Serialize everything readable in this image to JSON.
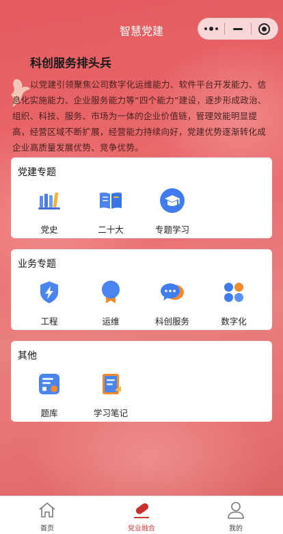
{
  "header": {
    "title": "智慧党建"
  },
  "intro": {
    "title": "科创服务排头兵",
    "text": "以党建引领聚焦公司数字化运维能力、软件平台开发能力、信息化实施能力、企业服务能力等“四个能力”建设，逐步形成政治、组织、科技、服务、市场为一体的企业价值链，管理效能明显提高，经营区域不断扩展，经营能力持续向好，党建优势逐渐转化成企业高质量发展优势、竞争优势。"
  },
  "sections": {
    "party": {
      "title": "党建专题",
      "items": [
        {
          "label": "党史",
          "icon": "books-icon"
        },
        {
          "label": "二十大",
          "icon": "open-book-icon"
        },
        {
          "label": "专题学习",
          "icon": "graduation-cap-icon"
        }
      ]
    },
    "business": {
      "title": "业务专题",
      "items": [
        {
          "label": "工程",
          "icon": "lightning-shield-icon"
        },
        {
          "label": "运维",
          "icon": "badge-icon"
        },
        {
          "label": "科创服务",
          "icon": "chat-bubbles-icon"
        },
        {
          "label": "数字化",
          "icon": "four-petal-icon"
        }
      ]
    },
    "other": {
      "title": "其他",
      "items": [
        {
          "label": "题库",
          "icon": "question-bank-icon"
        },
        {
          "label": "学习笔记",
          "icon": "notebook-icon"
        }
      ]
    }
  },
  "tabbar": {
    "items": [
      {
        "label": "首页",
        "icon": "home-icon"
      },
      {
        "label": "党业融合",
        "icon": "pill-icon",
        "active": true
      },
      {
        "label": "我的",
        "icon": "user-icon"
      }
    ]
  },
  "colors": {
    "accent": "#d23a3a",
    "iconBlue": "#3f7cf0",
    "iconOrange": "#f08a2c"
  }
}
